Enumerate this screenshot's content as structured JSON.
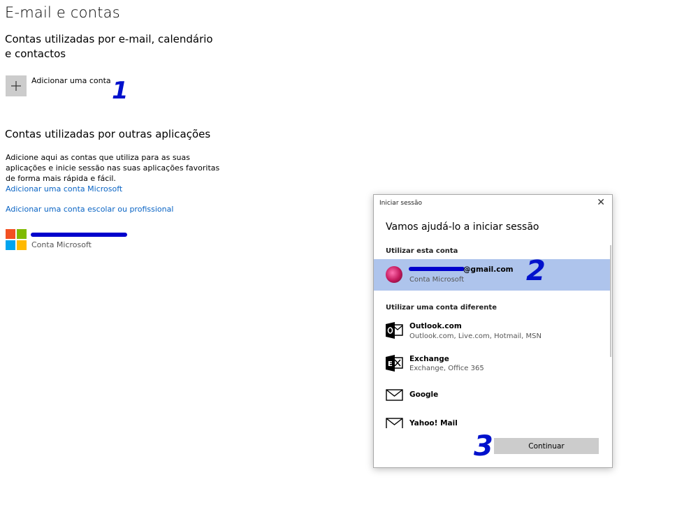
{
  "page": {
    "title": "E-mail e contas",
    "email_section_title": "Contas utilizadas por e-mail, calendário e contactos",
    "add_account_label": "Adicionar uma conta",
    "other_apps_title": "Contas utilizadas por outras aplicações",
    "other_apps_description": "Adicione aqui as contas que utiliza para as suas aplicações e inicie sessão nas suas aplicações favoritas de forma mais rápida e fácil.",
    "add_microsoft_link": "Adicionar uma conta Microsoft",
    "add_work_link": "Adicionar uma conta escolar ou profissional",
    "existing_account_type": "Conta Microsoft"
  },
  "annotations": {
    "step1": "1",
    "step2": "2",
    "step3": "3"
  },
  "dialog": {
    "title": "Iniciar sessão",
    "close_glyph": "✕",
    "heading": "Vamos ajudá-lo a iniciar sessão",
    "use_this_account_label": "Utilizar esta conta",
    "selected_account": {
      "email_visible": "@gmail.com",
      "type": "Conta Microsoft"
    },
    "use_different_label": "Utilizar uma conta diferente",
    "options": [
      {
        "name": "Outlook.com",
        "description": "Outlook.com, Live.com, Hotmail, MSN",
        "icon": "outlook-icon"
      },
      {
        "name": "Exchange",
        "description": "Exchange, Office 365",
        "icon": "exchange-icon"
      },
      {
        "name": "Google",
        "description": "",
        "icon": "mail-icon"
      },
      {
        "name": "Yahoo! Mail",
        "description": "",
        "icon": "mail-icon"
      }
    ],
    "continue_label": "Continuar"
  },
  "colors": {
    "link": "#0a64c4",
    "selection": "#aec4ec",
    "button": "#cccccc",
    "annotation": "#0011cc",
    "ms_red": "#f25022",
    "ms_green": "#7fba00",
    "ms_blue": "#00a4ef",
    "ms_yellow": "#ffb900"
  }
}
